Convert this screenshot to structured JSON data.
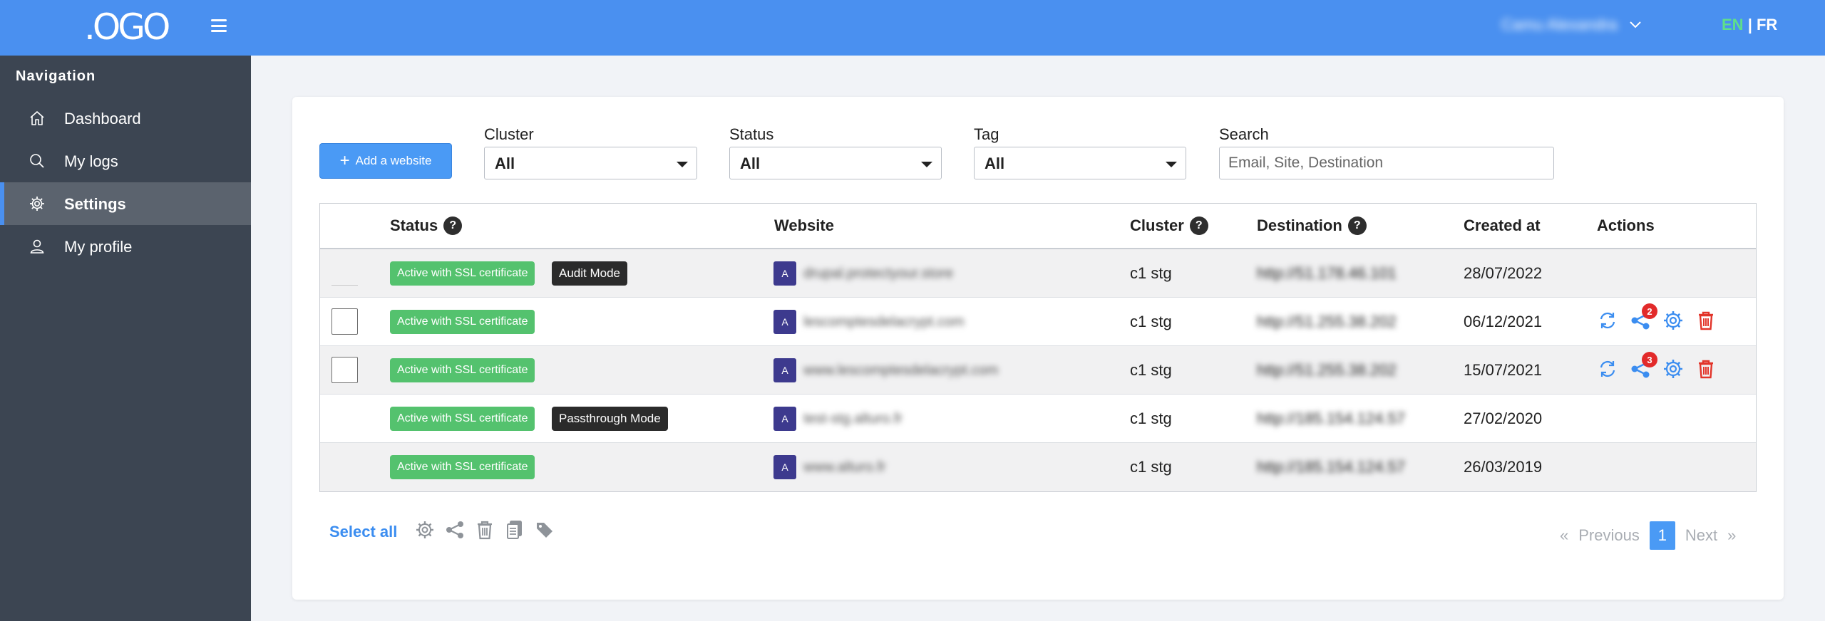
{
  "header": {
    "logo": ".OGO",
    "user_name": "Camu Alexandra",
    "lang_en": "EN",
    "lang_sep": "|",
    "lang_fr": "FR"
  },
  "sidebar": {
    "title": "Navigation",
    "items": [
      {
        "label": "Dashboard",
        "icon": "home-icon"
      },
      {
        "label": "My logs",
        "icon": "search-icon"
      },
      {
        "label": "Settings",
        "icon": "gear-icon",
        "active": true
      },
      {
        "label": "My profile",
        "icon": "user-icon"
      }
    ]
  },
  "toolbar": {
    "add_label": "Add a website",
    "cluster": {
      "label": "Cluster",
      "value": "All"
    },
    "status": {
      "label": "Status",
      "value": "All"
    },
    "tag": {
      "label": "Tag",
      "value": "All"
    },
    "search": {
      "label": "Search",
      "placeholder": "Email, Site, Destination"
    }
  },
  "table": {
    "columns": {
      "status": "Status",
      "website": "Website",
      "cluster": "Cluster",
      "destination": "Destination",
      "created": "Created at",
      "actions": "Actions"
    },
    "help_glyph": "?",
    "rows": [
      {
        "status": "Active with SSL certificate",
        "mode": "Audit Mode",
        "avatar": "A",
        "website": "drupal.protectyour.store",
        "cluster": "c1 stg",
        "destination": "http://51.178.46.101",
        "created": "28/07/2022"
      },
      {
        "status": "Active with SSL certificate",
        "mode": "",
        "avatar": "A",
        "website": "lescomptesdelacrypt.com",
        "cluster": "c1 stg",
        "destination": "http://51.255.38.202",
        "created": "06/12/2021",
        "share_count": "2"
      },
      {
        "status": "Active with SSL certificate",
        "mode": "",
        "avatar": "A",
        "website": "www.lescomptesdelacrypt.com",
        "cluster": "c1 stg",
        "destination": "http://51.255.38.202",
        "created": "15/07/2021",
        "share_count": "3"
      },
      {
        "status": "Active with SSL certificate",
        "mode": "Passthrough Mode",
        "avatar": "A",
        "website": "test-stg.alturo.fr",
        "cluster": "c1 stg",
        "destination": "http://185.154.124.57",
        "created": "27/02/2020"
      },
      {
        "status": "Active with SSL certificate",
        "mode": "",
        "avatar": "A",
        "website": "www.alturo.fr",
        "cluster": "c1 stg",
        "destination": "http://185.154.124.57",
        "created": "26/03/2019"
      }
    ]
  },
  "footer": {
    "select_all": "Select all",
    "prev_glyph": "«",
    "prev": "Previous",
    "page": "1",
    "next": "Next",
    "next_glyph": "»"
  },
  "colors": {
    "accent": "#4a90f0",
    "success": "#54c26e",
    "danger": "#e2342a",
    "sidebar": "#3c4552"
  }
}
